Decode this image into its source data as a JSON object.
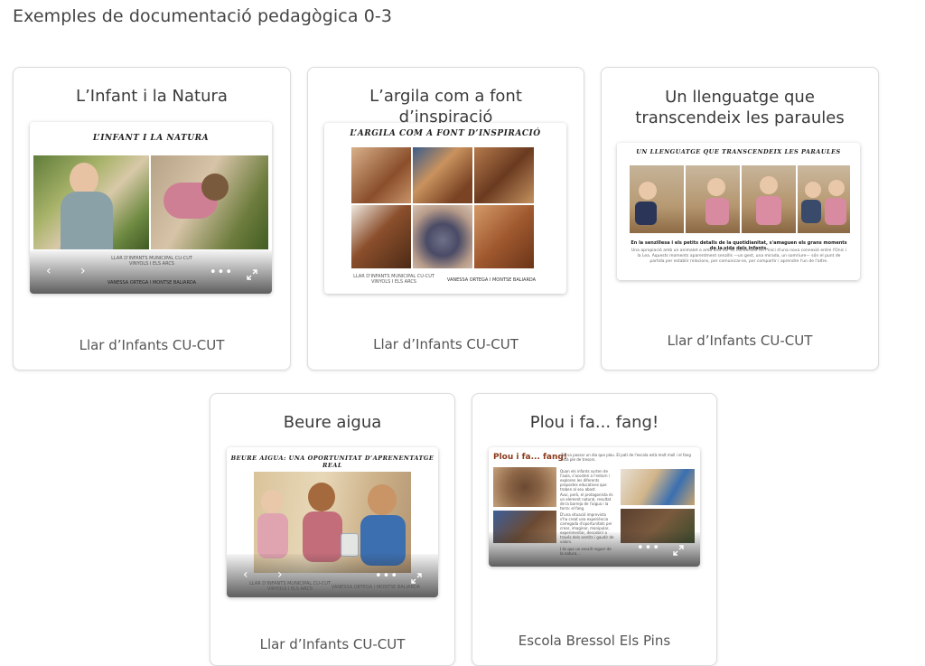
{
  "page": {
    "title": "Exemples de documentació pedagògica 0-3"
  },
  "cards": [
    {
      "title": "L’Infant i la Natura",
      "doc_heading": "L’INFANT I LA NATURA",
      "doc_credit_1": "LLAR D'INFANTS MUNICIPAL CU-CUT",
      "doc_credit_2": "VINYOLS I ELS ARCS",
      "doc_authors": "VANESSA ORTEGA I MONTSE BALIARDA",
      "footer": "Llar d’Infants CU-CUT"
    },
    {
      "title": "L’argila com a font d’inspiració",
      "doc_heading": "L’ARGILA COM A FONT D’INSPIRACIÓ",
      "doc_credit_1": "LLAR D'INFANTS MUNICIPAL CU-CUT",
      "doc_credit_2": "VINYOLS I ELS ARCS",
      "doc_authors": "VANESSA ORTEGA I MONTSE BALIARDA",
      "footer": "Llar d’Infants CU-CUT"
    },
    {
      "title": "Un llenguatge que transcendeix les paraules",
      "doc_heading": "UN LLENGUATGE QUE TRANSCENDEIX LES PARAULES",
      "doc_caption": "En la senzillesa i els petits detalls de la quotidianitat, s'amaguen els grans moments de la vida dels infants.",
      "doc_body": "Una apropiació amb un animalet o amb una flor es converteix en l'inici d'una nova connexió entre l'Onic i la Lea. Aquests moments aparentment senzills —un gest, una mirada, un somriure— són el punt de partida per establir relacions, per comunicar-se, per compartir i aprendre l'un de l'altre.",
      "footer": "Llar d’Infants CU-CUT"
    },
    {
      "title": "Beure aigua",
      "doc_heading": "BEURE AIGUA: UNA OPORTUNITAT D’APRENENTATGE REAL",
      "doc_credit_1": "LLAR D'INFANTS MUNICIPAL CU-CUT",
      "doc_credit_2": "VINYOLS I ELS ARCS",
      "doc_authors": "VANESSA ORTEGA I MONTSE BALIARDA",
      "footer": "Llar d’Infants CU-CUT"
    },
    {
      "title": "Plou i fa... fang!",
      "doc_heading": "Plou i fa... fang!",
      "doc_intro": "Tot va passar un dia que plou. El pati de l'escola està molt moll i el fang està ple de tresors.",
      "doc_col_1": "Quan els infants surten de l'aula, s'acosten a l'entorn i exploren les diferents propostes educatives que troben al seu abast.",
      "doc_col_2": "Avui, però, el protagonista és un element natural, resultat de la barreja de l'aigua i la terra: el fang.",
      "doc_col_3": "D'una situació imprevista s'ha creat una experiència carregada d'oportunitats per crear, imaginar, manipular, experimentar, descobrir a través dels sentits i gaudir de valors.",
      "doc_col_4": "I és que un senzill reguer de la natura...",
      "footer": "Escola Bressol Els Pins"
    }
  ],
  "viewer": {
    "prev": "‹",
    "next": "›",
    "more": "•••"
  }
}
